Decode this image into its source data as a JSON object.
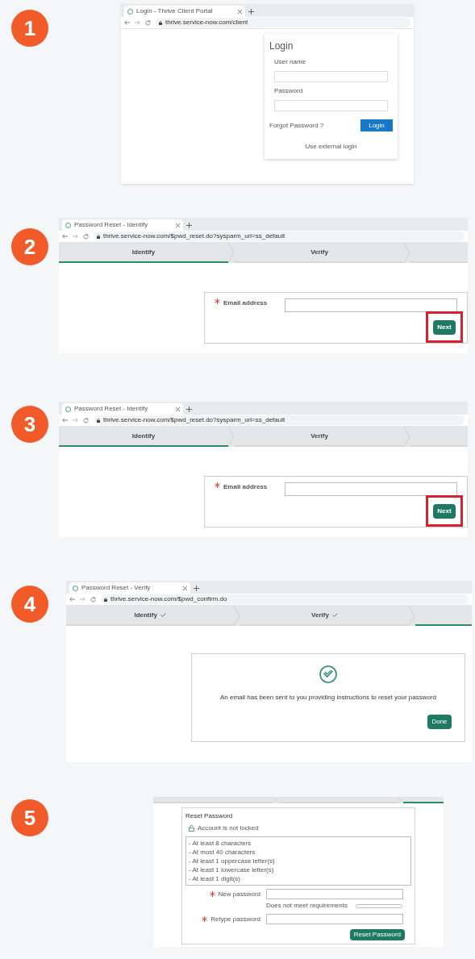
{
  "steps": [
    {
      "number": "1",
      "kind": "login",
      "browser": {
        "tab_title": "Login - Thrive Client Portal",
        "url": "thrive.service-now.com/client"
      },
      "login": {
        "title": "Login",
        "fields": [
          {
            "label": "User name"
          },
          {
            "label": "Password"
          }
        ],
        "forgot": "Forgot Password ?",
        "button": "Login",
        "external": "Use external login"
      }
    },
    {
      "number": "2",
      "kind": "identify",
      "browser": {
        "tab_title": "Password Reset - Identify",
        "url": "thrive.service-now.com/$pwd_reset.do?sysparm_url=ss_default"
      },
      "progress": [
        {
          "label": "Identify",
          "selected": true,
          "done": false
        },
        {
          "label": "Verify",
          "selected": false,
          "done": false
        },
        {
          "selected": false,
          "done": false
        }
      ],
      "form": {
        "label": "Email address",
        "button": "Next",
        "highlighted": true
      }
    },
    {
      "number": "3",
      "kind": "identify",
      "browser": {
        "tab_title": "Password Reset - Identify",
        "url": "thrive.service-now.com/$pwd_reset.do?sysparm_url=ss_default"
      },
      "progress": [
        {
          "label": "Identify",
          "selected": true,
          "done": false
        },
        {
          "label": "Verify",
          "selected": false,
          "done": false
        },
        {
          "selected": false,
          "done": false
        }
      ],
      "form": {
        "label": "Email address",
        "button": "Next",
        "highlighted": true
      }
    },
    {
      "number": "4",
      "kind": "verify",
      "browser": {
        "tab_title": "Password Reset - Verify",
        "url": "thrive.service-now.com/$pwd_confirm.do"
      },
      "progress": [
        {
          "label": "Identify",
          "selected": false,
          "done": true
        },
        {
          "label": "Verify",
          "selected": false,
          "done": true
        },
        {
          "selected": true,
          "done": false
        }
      ],
      "message": "An email has been sent to you providing instructions to reset your password",
      "button": "Done"
    },
    {
      "number": "5",
      "kind": "reset",
      "progress": [
        {
          "selected": false,
          "done": false
        },
        {
          "selected": false,
          "done": false
        },
        {
          "selected": true,
          "done": false
        }
      ],
      "title": "Reset Password",
      "lock_status": "Account is not locked",
      "requirements": [
        "- At least 8 characters",
        "- At most 40 characters",
        "- At least 1 uppercase letter(s)",
        "- At least 1 lowercase letter(s)",
        "- At least 1 digit(s)"
      ],
      "fields": [
        {
          "label": "New password"
        },
        {
          "label": "Retype password"
        }
      ],
      "strength": {
        "text": "Does not meet requirements",
        "level": 0
      },
      "button": "Reset Password"
    }
  ]
}
